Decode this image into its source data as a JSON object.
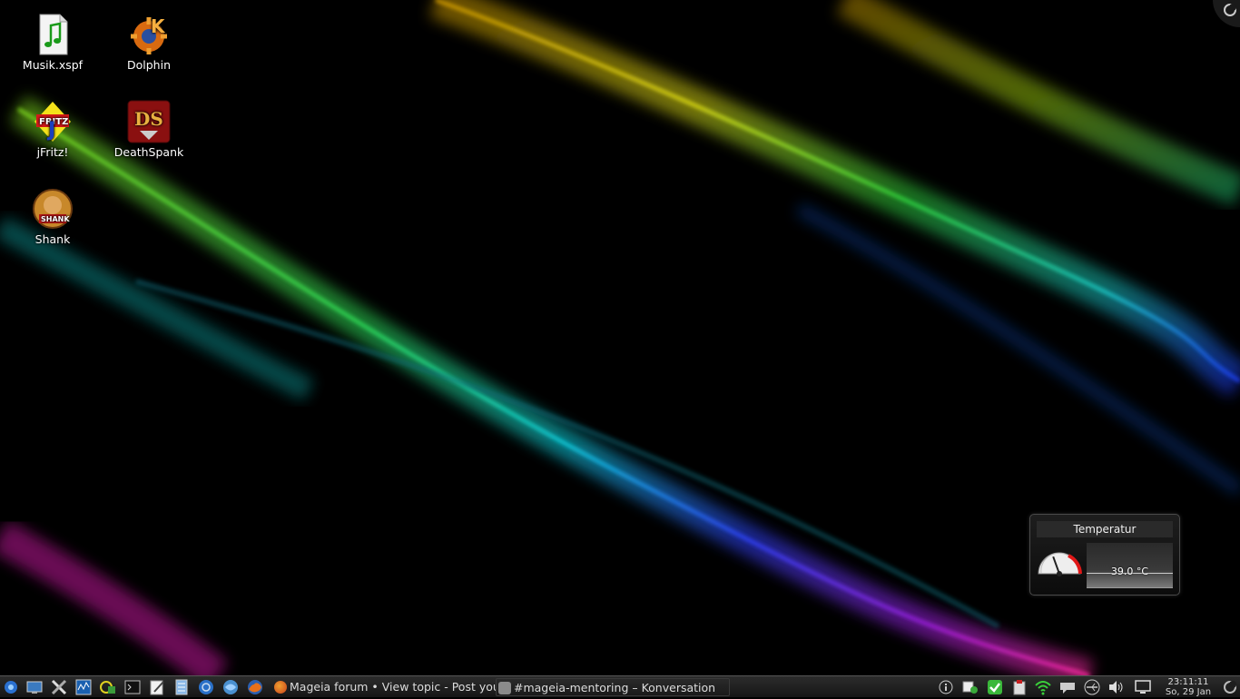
{
  "desktop": {
    "icons": [
      {
        "label": "Musik.xspf",
        "icon": "music-playlist-icon"
      },
      {
        "label": "Dolphin",
        "icon": "dolphin-icon"
      },
      {
        "label": "jFritz!",
        "icon": "jfritz-icon"
      },
      {
        "label": "DeathSpank",
        "icon": "deathspank-icon"
      },
      {
        "label": "Shank",
        "icon": "shank-icon"
      }
    ]
  },
  "widget": {
    "title": "Temperatur",
    "value": "39.0 °C",
    "gauge_fraction": 0.39
  },
  "taskbar": {
    "launchers": [
      "kde-menu-icon",
      "desktop-icon",
      "system-settings-icon",
      "system-monitor-icon",
      "package-manager-icon",
      "terminal-icon",
      "text-editor-icon",
      "file-manager-icon",
      "network-icon",
      "browser-icon",
      "firefox-icon"
    ],
    "tasks": [
      {
        "label": "Mageia forum • View topic - Post you",
        "icon": "firefox-icon"
      },
      {
        "label": "#mageia-mentoring – Konversation",
        "icon": "konversation-icon"
      }
    ],
    "tray": [
      "info-icon",
      "notifications-icon",
      "update-check-icon",
      "clipboard-icon",
      "wifi-icon",
      "chat-icon",
      "usb-device-icon",
      "volume-icon",
      "display-icon"
    ],
    "clock": {
      "time": "23:11:11",
      "date": "So, 29 Jan"
    }
  },
  "colors": {
    "taskbar": "#1f1f1f",
    "accent_green": "#39e03a"
  }
}
